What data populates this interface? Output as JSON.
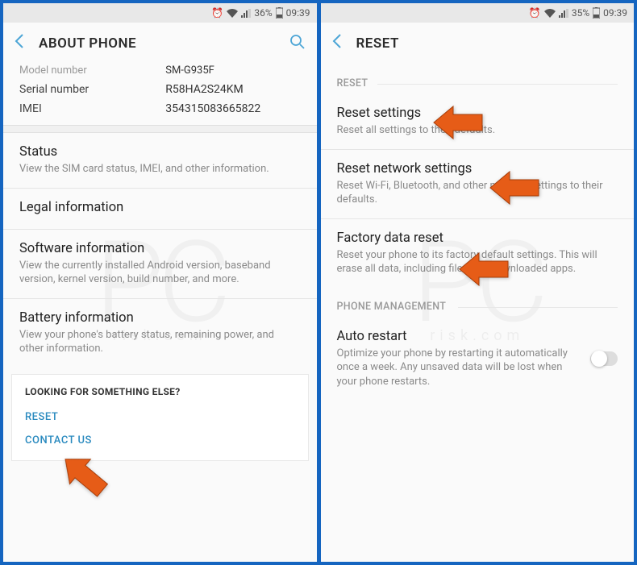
{
  "left": {
    "status": {
      "battery": "36%",
      "time": "09:39"
    },
    "header": {
      "title": "ABOUT PHONE"
    },
    "info": {
      "model_label": "Model number",
      "model_value": "SM-G935F",
      "serial_label": "Serial number",
      "serial_value": "R58HA2S24KM",
      "imei_label": "IMEI",
      "imei_value": "354315083665822"
    },
    "items": {
      "status": {
        "title": "Status",
        "desc": "View the SIM card status, IMEI, and other information."
      },
      "legal": {
        "title": "Legal information"
      },
      "software": {
        "title": "Software information",
        "desc": "View the currently installed Android version, baseband version, kernel version, build number, and more."
      },
      "battery": {
        "title": "Battery information",
        "desc": "View your phone's battery status, remaining power, and other information."
      }
    },
    "footer": {
      "heading": "LOOKING FOR SOMETHING ELSE?",
      "reset": "RESET",
      "contact": "CONTACT US"
    }
  },
  "right": {
    "status": {
      "battery": "35%",
      "time": "09:39"
    },
    "header": {
      "title": "RESET"
    },
    "sections": {
      "reset": "RESET",
      "phone_mgmt": "PHONE MANAGEMENT"
    },
    "items": {
      "reset_settings": {
        "title": "Reset settings",
        "desc": "Reset all settings to their defaults."
      },
      "reset_network": {
        "title": "Reset network settings",
        "desc": "Reset Wi-Fi, Bluetooth, and other network settings to their defaults."
      },
      "factory": {
        "title": "Factory data reset",
        "desc": "Reset your phone to its factory default settings. This will erase all data, including files and downloaded apps."
      },
      "auto_restart": {
        "title": "Auto restart",
        "desc": "Optimize your phone by restarting it automatically once a week. Any unsaved data will be lost when your phone restarts."
      }
    }
  },
  "watermark": {
    "main": "PC",
    "sub": "risk.com"
  }
}
